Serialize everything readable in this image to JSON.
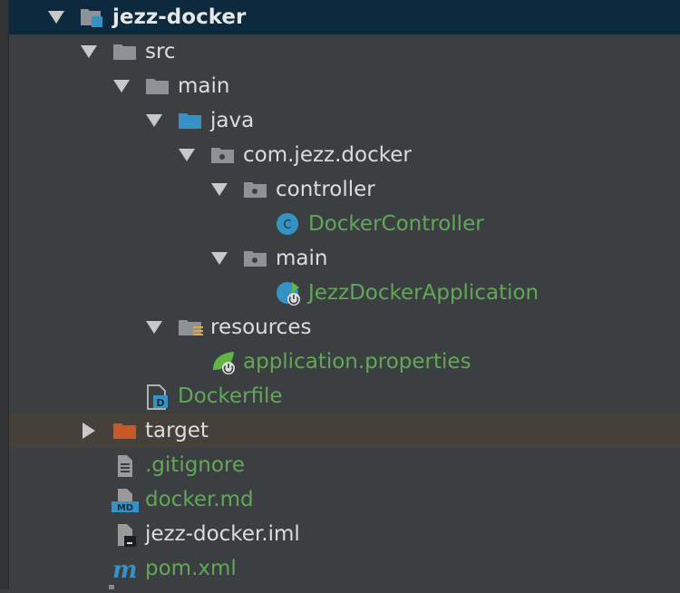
{
  "tree": {
    "root": {
      "label": "jezz-docker",
      "icon": "module-folder-icon",
      "expanded": true
    },
    "src": {
      "label": "src",
      "icon": "folder-icon",
      "expanded": true
    },
    "main": {
      "label": "main",
      "icon": "folder-icon",
      "expanded": true
    },
    "java": {
      "label": "java",
      "icon": "source-root-folder-icon",
      "expanded": true
    },
    "pkg": {
      "label": "com.jezz.docker",
      "icon": "package-icon",
      "expanded": true
    },
    "controller_pkg": {
      "label": "controller",
      "icon": "package-icon",
      "expanded": true
    },
    "docker_controller": {
      "label": "DockerController",
      "icon": "java-class-icon",
      "badge": "C"
    },
    "main_pkg": {
      "label": "main",
      "icon": "package-icon",
      "expanded": true
    },
    "app_class": {
      "label": "JezzDockerApplication",
      "icon": "spring-boot-class-icon"
    },
    "resources": {
      "label": "resources",
      "icon": "resources-folder-icon",
      "expanded": true
    },
    "app_props": {
      "label": "application.properties",
      "icon": "spring-properties-icon"
    },
    "dockerfile": {
      "label": "Dockerfile",
      "icon": "dockerfile-icon",
      "badge": "D"
    },
    "target": {
      "label": "target",
      "icon": "excluded-folder-icon",
      "expanded": false
    },
    "gitignore": {
      "label": ".gitignore",
      "icon": "text-file-icon"
    },
    "docker_md": {
      "label": "docker.md",
      "icon": "markdown-file-icon",
      "badge": "MD"
    },
    "iml": {
      "label": "jezz-docker.iml",
      "icon": "iml-file-icon"
    },
    "pom": {
      "label": "pom.xml",
      "icon": "maven-icon",
      "badge": "m"
    }
  },
  "colors": {
    "background": "#3c3f41",
    "selected_row": "#0d293e",
    "excluded_row": "#45403a",
    "default_text": "#dcdcdc",
    "vcs_added_text": "#62a758",
    "folder": "#8e9297",
    "source_folder": "#3592c4",
    "excluded_folder": "#c7582a"
  }
}
